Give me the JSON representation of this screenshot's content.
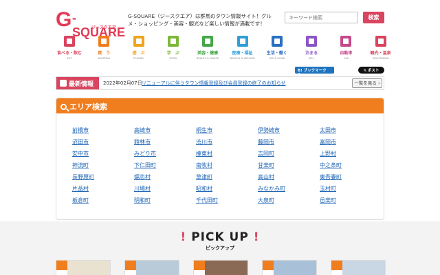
{
  "header": {
    "logo_g": "G",
    "logo_main": "-SQUARE",
    "logo_sub": "ジースクエア",
    "tagline": "G-SQUARE（ジースクエア）は群馬のタウン情報サイト！グルメ・ショッピング・美容・観光など楽しい情報が満載です！",
    "search_placeholder": "キーワード検索",
    "search_button": "検索"
  },
  "categories": [
    {
      "label": "食べる・飲む",
      "en": "EAT",
      "color": "#d9445f"
    },
    {
      "label": "買　う",
      "en": "SHOPPING",
      "color": "#f07d1e"
    },
    {
      "label": "遊　ぶ",
      "en": "PLAYING",
      "color": "#f0a41e"
    },
    {
      "label": "学　ぶ",
      "en": "STUDY",
      "color": "#7cb83a"
    },
    {
      "label": "美容・健康",
      "en": "BEAUTY & HEALTH",
      "color": "#45a84a"
    },
    {
      "label": "医療・福祉",
      "en": "MEDICAL & WELFARE",
      "color": "#2f9fd8"
    },
    {
      "label": "生活・働く",
      "en": "LIFE & WORK",
      "color": "#2a6fc4"
    },
    {
      "label": "泊まる",
      "en": "SELL",
      "color": "#8a55c4"
    },
    {
      "label": "自動車",
      "en": "CAR",
      "color": "#c44a8a"
    },
    {
      "label": "観光・温泉",
      "en": "SIGHTSEEING",
      "color": "#d9445f"
    }
  ],
  "social": {
    "bookmark": "B! ブックマーク　4",
    "post": "𝕏 ポスト"
  },
  "news": {
    "tag": "最新情報",
    "date": "2022年02月07日",
    "link": "リニューアルに伴うタウン情報登録及び会員登録の終了のお知らせ",
    "more": "一覧を見る ›"
  },
  "area": {
    "title": "エリア検索",
    "columns": [
      [
        "前橋市",
        "沼田市",
        "安中市",
        "神流町",
        "長野原町",
        "片品村",
        "板倉町"
      ],
      [
        "高崎市",
        "館林市",
        "みどり市",
        "下仁田町",
        "嬬恋村",
        "川場村",
        "明和町"
      ],
      [
        "桐生市",
        "渋川市",
        "榛東村",
        "南牧村",
        "草津町",
        "昭和村",
        "千代田町"
      ],
      [
        "伊勢崎市",
        "藤岡市",
        "吉岡町",
        "甘楽町",
        "高山村",
        "みなかみ町",
        "大泉町"
      ],
      [
        "太田市",
        "富岡市",
        "上野村",
        "中之条町",
        "東吾妻町",
        "玉村町",
        "邑楽町"
      ]
    ]
  },
  "pickup": {
    "title": "PICK UP",
    "subtitle": "ピックアップ"
  }
}
